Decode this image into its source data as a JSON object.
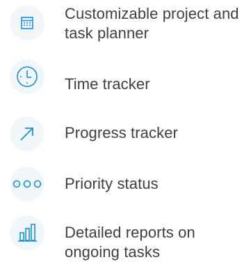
{
  "accent_color": "#1a8fd6",
  "features": [
    {
      "icon": "calendar-icon",
      "label": "Customizable project and task planner"
    },
    {
      "icon": "clock-icon",
      "label": "Time tracker"
    },
    {
      "icon": "arrow-up-right-icon",
      "label": "Progress tracker"
    },
    {
      "icon": "dots-icon",
      "label": "Priority status"
    },
    {
      "icon": "bar-chart-icon",
      "label": "Detailed reports on ongoing tasks"
    }
  ]
}
